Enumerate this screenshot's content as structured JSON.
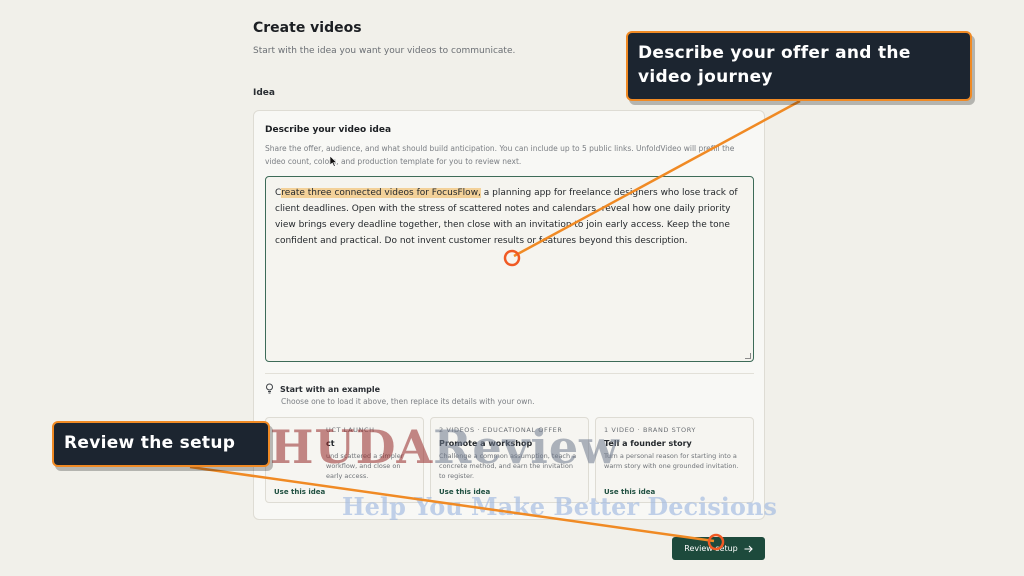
{
  "header": {
    "title": "Create videos",
    "subtitle": "Start with the idea you want your videos to communicate."
  },
  "idea_section": {
    "label": "Idea",
    "card_heading": "Describe your video idea",
    "help_text": "Share the offer, audience, and what should build anticipation. You can include up to 5 public links. UnfoldVideo will prefill the video count, colors, and production template for you to review next.",
    "textarea_lead": "C",
    "textarea_highlight": "reate three connected videos for FocusFlow,",
    "textarea_rest": " a planning app for freelance designers who lose track of client deadlines. Open with the stress of scattered notes and calendars, reveal how one daily priority view brings every deadline together, then close with an invitation to join early access. Keep the tone confident and practical. Do not invent customer results or features beyond this description."
  },
  "examples": {
    "heading": "Start with an example",
    "subheading": "Choose one to load it above, then replace its details with your own.",
    "items": [
      {
        "tag": "UCT LAUNCH",
        "title": "ct",
        "desc": "und scattered a simpler workflow, and close on early access.",
        "link": "Use this idea"
      },
      {
        "tag": "2 VIDEOS · EDUCATIONAL OFFER",
        "title": "Promote a workshop",
        "desc": "Challenge a common assumption, teach a concrete method, and earn the invitation to register.",
        "link": "Use this idea"
      },
      {
        "tag": "1 VIDEO · BRAND STORY",
        "title": "Tell a founder story",
        "desc": "Turn a personal reason for starting into a warm story with one grounded invitation.",
        "link": "Use this idea"
      }
    ]
  },
  "actions": {
    "review_label": "Review setup",
    "review_icon": "arrow-right-icon"
  },
  "annotations": {
    "offer_callout": "Describe your offer and the video journey",
    "review_callout": "Review the setup",
    "accent_color": "#f08a24"
  },
  "watermark": {
    "main_a": "HUDA",
    "main_b": "Review",
    "sub": "Help You Make Better Decisions"
  }
}
